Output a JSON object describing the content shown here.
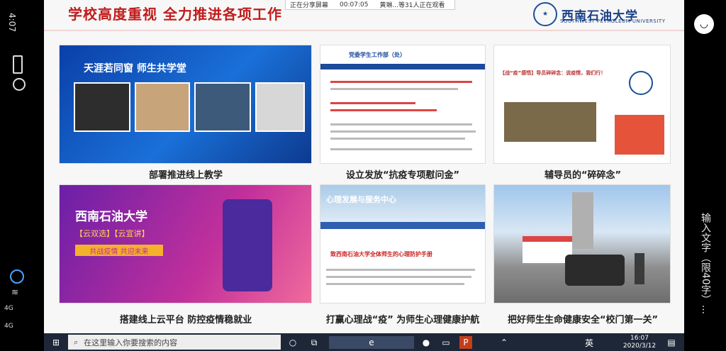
{
  "phone": {
    "time": "4:07",
    "network_a": "4G",
    "network_b": "4G"
  },
  "meeting": {
    "sharing_label": "正在分享屏幕",
    "elapsed": "00:07:05",
    "viewers": "黄琳...等31人正在观看"
  },
  "slide": {
    "title": "学校高度重视 全力推进各项工作",
    "logo_cn": "西南石油大学",
    "logo_en": "SOUTHWEST PETROLEUM UNIVERSITY",
    "cards": [
      {
        "caption": "部署推进线上教学",
        "banner": "天涯若同窗 师生共学堂"
      },
      {
        "caption": "设立发放“抗疫专项慰问金”",
        "banner": "党委学生工作部（处）"
      },
      {
        "caption": "辅导员的“碎碎念”",
        "banner": "【战“疫”感悟】导员碎碎念：说疫情，我们行！"
      },
      {
        "caption": "搭建线上云平台 防控疫情稳就业",
        "banner": "西南石油大学",
        "sub": "【云双选】【云宣讲】",
        "tag": "共战疫情 共迎未来"
      },
      {
        "caption": "打赢心理战“疫” 为师生心理健康护航",
        "banner": "心理发展与服务中心",
        "sub": "致西南石油大学全体师生的心理防护手册"
      },
      {
        "caption": "把好师生生命健康安全“校门第一关”",
        "banner": ""
      }
    ]
  },
  "overlay_text": "输入文字（限40字）...",
  "taskbar": {
    "search_placeholder": "在这里输入你要搜索的内容",
    "clock_time": "16:07",
    "clock_date": "2020/3/12",
    "ime": "英"
  },
  "colors": {
    "title_red": "#c21b1b",
    "logo_blue": "#1a3f86",
    "taskbar": "#1d2737"
  }
}
